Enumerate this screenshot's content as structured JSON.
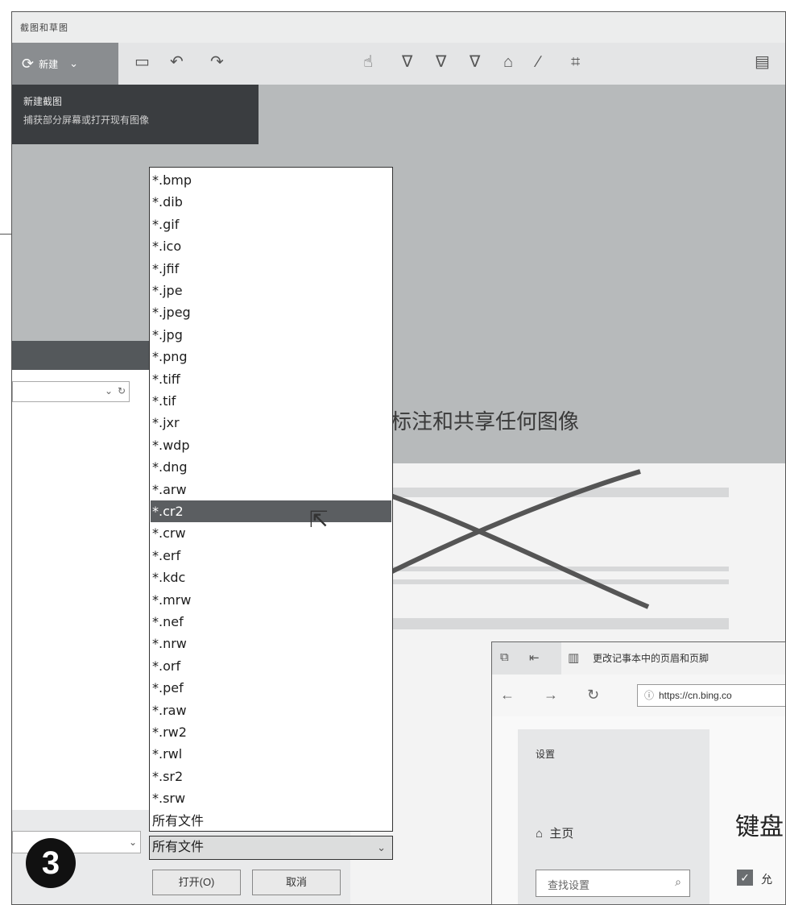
{
  "app": {
    "title": "截图和草图",
    "new_label": "新建",
    "tooltip_title": "新建截图",
    "tooltip_desc": "捕获部分屏幕或打开现有图像",
    "hero_text": "标注和共享任何图像"
  },
  "toolbar": {
    "icons": [
      "folder-icon",
      "undo-icon",
      "redo-icon",
      "touch-writing-icon",
      "ballpoint-pen-icon",
      "pencil-icon",
      "highlighter-icon",
      "eraser-icon",
      "ruler-icon",
      "crop-icon",
      "save-icon"
    ]
  },
  "file_dialog": {
    "type_options": [
      "*.bmp",
      "*.dib",
      "*.gif",
      "*.ico",
      "*.jfif",
      "*.jpe",
      "*.jpeg",
      "*.jpg",
      "*.png",
      "*.tiff",
      "*.tif",
      "*.jxr",
      "*.wdp",
      "*.dng",
      "*.arw",
      "*.cr2",
      "*.crw",
      "*.erf",
      "*.kdc",
      "*.mrw",
      "*.nef",
      "*.nrw",
      "*.orf",
      "*.pef",
      "*.raw",
      "*.rw2",
      "*.rwl",
      "*.sr2",
      "*.srw",
      "所有文件"
    ],
    "selected_option": "*.cr2",
    "type_select_value": "所有文件",
    "open_label": "打开(O)",
    "cancel_label": "取消"
  },
  "step_badge": "3",
  "browser": {
    "tab_title": "更改记事本中的页眉和页脚",
    "address": "https://cn.bing.co",
    "settings": {
      "title": "设置",
      "home": "主页",
      "search_placeholder": "查找设置",
      "heading": "键盘",
      "checkbox_label": "允"
    }
  }
}
